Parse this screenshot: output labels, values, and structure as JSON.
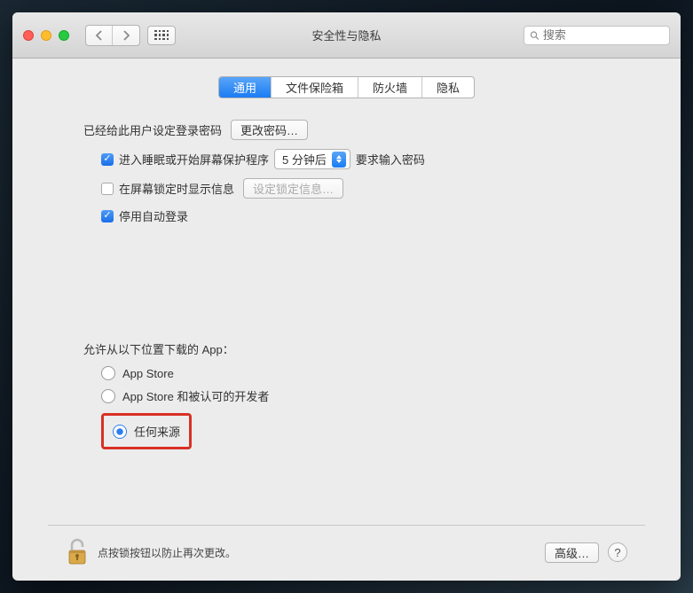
{
  "window": {
    "title": "安全性与隐私",
    "search_placeholder": "搜索"
  },
  "tabs": [
    {
      "label": "通用",
      "active": true
    },
    {
      "label": "文件保险箱",
      "active": false
    },
    {
      "label": "防火墙",
      "active": false
    },
    {
      "label": "隐私",
      "active": false
    }
  ],
  "login_section": {
    "set_password_text": "已经给此用户设定登录密码",
    "change_password_btn": "更改密码…",
    "sleep_checkbox": {
      "checked": true,
      "label_before": "进入睡眠或开始屏幕保护程序",
      "label_after": "要求输入密码"
    },
    "sleep_select_value": "5 分钟后",
    "lock_message_checkbox": {
      "checked": false,
      "label": "在屏幕锁定时显示信息"
    },
    "set_lock_message_btn": "设定锁定信息…",
    "disable_autologin_checkbox": {
      "checked": true,
      "label": "停用自动登录"
    }
  },
  "download_section": {
    "label": "允许从以下位置下载的 App：",
    "options": [
      {
        "label": "App Store",
        "selected": false
      },
      {
        "label": "App Store 和被认可的开发者",
        "selected": false
      },
      {
        "label": "任何来源",
        "selected": true,
        "highlighted": true
      }
    ]
  },
  "footer": {
    "lock_text": "点按锁按钮以防止再次更改。",
    "advanced_btn": "高级…",
    "help_btn": "?"
  }
}
